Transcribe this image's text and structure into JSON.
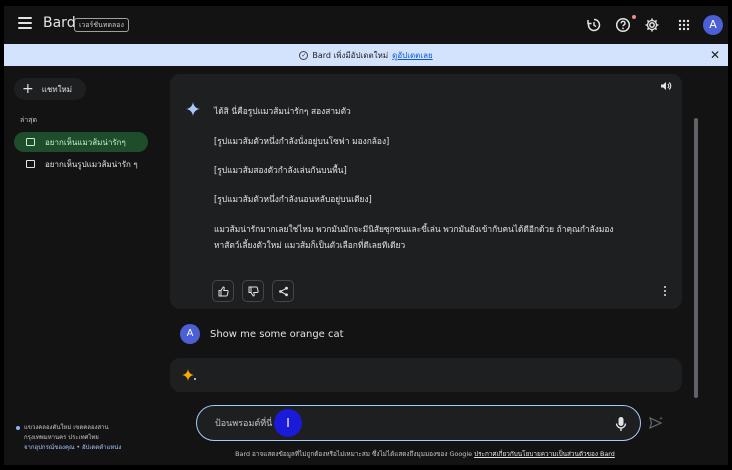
{
  "header": {
    "brand": "Bard",
    "badge": "เวอร์ชันทดลอง",
    "avatar_letter": "A",
    "icons": [
      "history-icon",
      "help-icon",
      "settings-icon",
      "apps-icon"
    ]
  },
  "banner": {
    "text": "Bard เพิ่งมีอัปเดตใหม่",
    "link": "ดูอัปเดตเลย"
  },
  "sidebar": {
    "new_chat": "แชทใหม่",
    "recent_label": "ล่าสุด",
    "items": [
      {
        "label": "อยากเห็นแมวส้มน่ารักๆ",
        "active": true
      },
      {
        "label": "อยากเห็นรูปแมวส้มน่ารัก ๆ",
        "active": false
      }
    ],
    "footer": {
      "line1": "แขวงคลองตันใหม่ เขตคลองสาน",
      "line2": "กรุงเทพมหานคร ประเทศไทย",
      "link1": "จากอุปกรณ์ของคุณ",
      "sep": " • ",
      "link2": "อัปเดตตำแหน่ง"
    }
  },
  "response": {
    "lines": [
      "ได้สิ นี่คือรูปแมวส้มน่ารักๆ สองสามตัว",
      "[รูปแมวส้มตัวหนึ่งกำลังนั่งอยู่บนโซฟา มองกล้อง]",
      "[รูปแมวส้มสองตัวกำลังเล่นกันบนพื้น]",
      "[รูปแมวส้มตัวหนึ่งกำลังนอนหลับอยู่บนเตียง]",
      "แมวส้มน่ารักมากเลยใช่ไหม พวกมันมักจะมีนิสัยซุกซนและขี้เล่น พวกมันยังเข้ากับคนได้ดีอีกด้วย ถ้าคุณกำลังมอง",
      "หาสัตว์เลี้ยงตัวใหม่ แมวส้มก็เป็นตัวเลือกที่ดีเลยทีเดียว"
    ]
  },
  "user_message": {
    "avatar_letter": "A",
    "text": "Show me some orange cat"
  },
  "input": {
    "placeholder": "ป้อนพรอมต์ที่นี่",
    "cursor_glyph": "I"
  },
  "disclaimer": {
    "text": "Bard อาจแสดงข้อมูลที่ไม่ถูกต้องหรือไม่เหมาะสม ซึ่งไม่ได้แสดงถึงมุมมองของ Google ",
    "link": "ประกาศเกี่ยวกับนโยบายความเป็นส่วนตัวของ Bard"
  },
  "colors": {
    "background": "#131314",
    "surface": "#1e1f20",
    "banner": "#d3e3fd",
    "active_item": "#1e4d2b",
    "avatar": "#4c5fd5",
    "accent": "#a8c7fa"
  }
}
